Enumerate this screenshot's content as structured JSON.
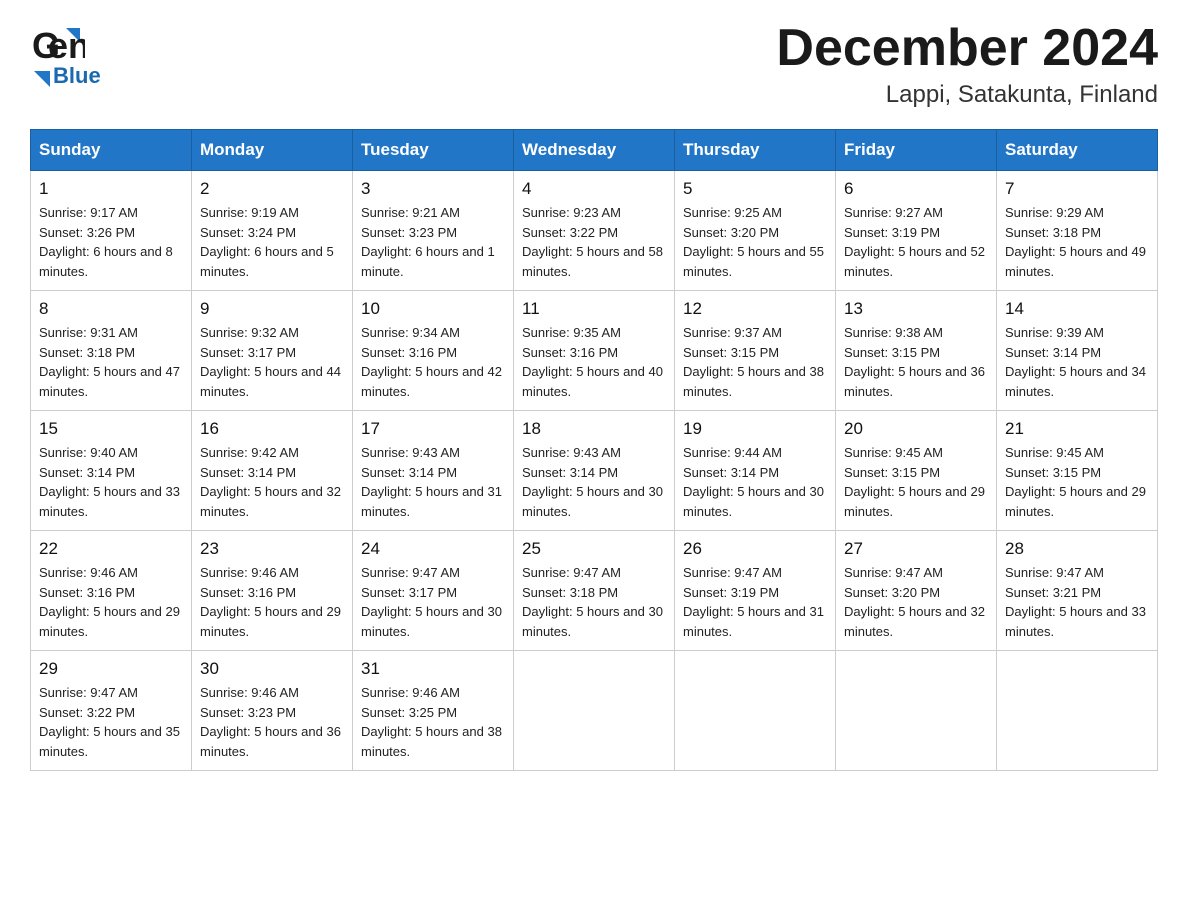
{
  "header": {
    "logo_general": "General",
    "logo_blue": "Blue",
    "month_title": "December 2024",
    "location": "Lappi, Satakunta, Finland"
  },
  "days_of_week": [
    "Sunday",
    "Monday",
    "Tuesday",
    "Wednesday",
    "Thursday",
    "Friday",
    "Saturday"
  ],
  "weeks": [
    [
      {
        "day": "1",
        "sunrise": "Sunrise: 9:17 AM",
        "sunset": "Sunset: 3:26 PM",
        "daylight": "Daylight: 6 hours and 8 minutes."
      },
      {
        "day": "2",
        "sunrise": "Sunrise: 9:19 AM",
        "sunset": "Sunset: 3:24 PM",
        "daylight": "Daylight: 6 hours and 5 minutes."
      },
      {
        "day": "3",
        "sunrise": "Sunrise: 9:21 AM",
        "sunset": "Sunset: 3:23 PM",
        "daylight": "Daylight: 6 hours and 1 minute."
      },
      {
        "day": "4",
        "sunrise": "Sunrise: 9:23 AM",
        "sunset": "Sunset: 3:22 PM",
        "daylight": "Daylight: 5 hours and 58 minutes."
      },
      {
        "day": "5",
        "sunrise": "Sunrise: 9:25 AM",
        "sunset": "Sunset: 3:20 PM",
        "daylight": "Daylight: 5 hours and 55 minutes."
      },
      {
        "day": "6",
        "sunrise": "Sunrise: 9:27 AM",
        "sunset": "Sunset: 3:19 PM",
        "daylight": "Daylight: 5 hours and 52 minutes."
      },
      {
        "day": "7",
        "sunrise": "Sunrise: 9:29 AM",
        "sunset": "Sunset: 3:18 PM",
        "daylight": "Daylight: 5 hours and 49 minutes."
      }
    ],
    [
      {
        "day": "8",
        "sunrise": "Sunrise: 9:31 AM",
        "sunset": "Sunset: 3:18 PM",
        "daylight": "Daylight: 5 hours and 47 minutes."
      },
      {
        "day": "9",
        "sunrise": "Sunrise: 9:32 AM",
        "sunset": "Sunset: 3:17 PM",
        "daylight": "Daylight: 5 hours and 44 minutes."
      },
      {
        "day": "10",
        "sunrise": "Sunrise: 9:34 AM",
        "sunset": "Sunset: 3:16 PM",
        "daylight": "Daylight: 5 hours and 42 minutes."
      },
      {
        "day": "11",
        "sunrise": "Sunrise: 9:35 AM",
        "sunset": "Sunset: 3:16 PM",
        "daylight": "Daylight: 5 hours and 40 minutes."
      },
      {
        "day": "12",
        "sunrise": "Sunrise: 9:37 AM",
        "sunset": "Sunset: 3:15 PM",
        "daylight": "Daylight: 5 hours and 38 minutes."
      },
      {
        "day": "13",
        "sunrise": "Sunrise: 9:38 AM",
        "sunset": "Sunset: 3:15 PM",
        "daylight": "Daylight: 5 hours and 36 minutes."
      },
      {
        "day": "14",
        "sunrise": "Sunrise: 9:39 AM",
        "sunset": "Sunset: 3:14 PM",
        "daylight": "Daylight: 5 hours and 34 minutes."
      }
    ],
    [
      {
        "day": "15",
        "sunrise": "Sunrise: 9:40 AM",
        "sunset": "Sunset: 3:14 PM",
        "daylight": "Daylight: 5 hours and 33 minutes."
      },
      {
        "day": "16",
        "sunrise": "Sunrise: 9:42 AM",
        "sunset": "Sunset: 3:14 PM",
        "daylight": "Daylight: 5 hours and 32 minutes."
      },
      {
        "day": "17",
        "sunrise": "Sunrise: 9:43 AM",
        "sunset": "Sunset: 3:14 PM",
        "daylight": "Daylight: 5 hours and 31 minutes."
      },
      {
        "day": "18",
        "sunrise": "Sunrise: 9:43 AM",
        "sunset": "Sunset: 3:14 PM",
        "daylight": "Daylight: 5 hours and 30 minutes."
      },
      {
        "day": "19",
        "sunrise": "Sunrise: 9:44 AM",
        "sunset": "Sunset: 3:14 PM",
        "daylight": "Daylight: 5 hours and 30 minutes."
      },
      {
        "day": "20",
        "sunrise": "Sunrise: 9:45 AM",
        "sunset": "Sunset: 3:15 PM",
        "daylight": "Daylight: 5 hours and 29 minutes."
      },
      {
        "day": "21",
        "sunrise": "Sunrise: 9:45 AM",
        "sunset": "Sunset: 3:15 PM",
        "daylight": "Daylight: 5 hours and 29 minutes."
      }
    ],
    [
      {
        "day": "22",
        "sunrise": "Sunrise: 9:46 AM",
        "sunset": "Sunset: 3:16 PM",
        "daylight": "Daylight: 5 hours and 29 minutes."
      },
      {
        "day": "23",
        "sunrise": "Sunrise: 9:46 AM",
        "sunset": "Sunset: 3:16 PM",
        "daylight": "Daylight: 5 hours and 29 minutes."
      },
      {
        "day": "24",
        "sunrise": "Sunrise: 9:47 AM",
        "sunset": "Sunset: 3:17 PM",
        "daylight": "Daylight: 5 hours and 30 minutes."
      },
      {
        "day": "25",
        "sunrise": "Sunrise: 9:47 AM",
        "sunset": "Sunset: 3:18 PM",
        "daylight": "Daylight: 5 hours and 30 minutes."
      },
      {
        "day": "26",
        "sunrise": "Sunrise: 9:47 AM",
        "sunset": "Sunset: 3:19 PM",
        "daylight": "Daylight: 5 hours and 31 minutes."
      },
      {
        "day": "27",
        "sunrise": "Sunrise: 9:47 AM",
        "sunset": "Sunset: 3:20 PM",
        "daylight": "Daylight: 5 hours and 32 minutes."
      },
      {
        "day": "28",
        "sunrise": "Sunrise: 9:47 AM",
        "sunset": "Sunset: 3:21 PM",
        "daylight": "Daylight: 5 hours and 33 minutes."
      }
    ],
    [
      {
        "day": "29",
        "sunrise": "Sunrise: 9:47 AM",
        "sunset": "Sunset: 3:22 PM",
        "daylight": "Daylight: 5 hours and 35 minutes."
      },
      {
        "day": "30",
        "sunrise": "Sunrise: 9:46 AM",
        "sunset": "Sunset: 3:23 PM",
        "daylight": "Daylight: 5 hours and 36 minutes."
      },
      {
        "day": "31",
        "sunrise": "Sunrise: 9:46 AM",
        "sunset": "Sunset: 3:25 PM",
        "daylight": "Daylight: 5 hours and 38 minutes."
      },
      null,
      null,
      null,
      null
    ]
  ]
}
